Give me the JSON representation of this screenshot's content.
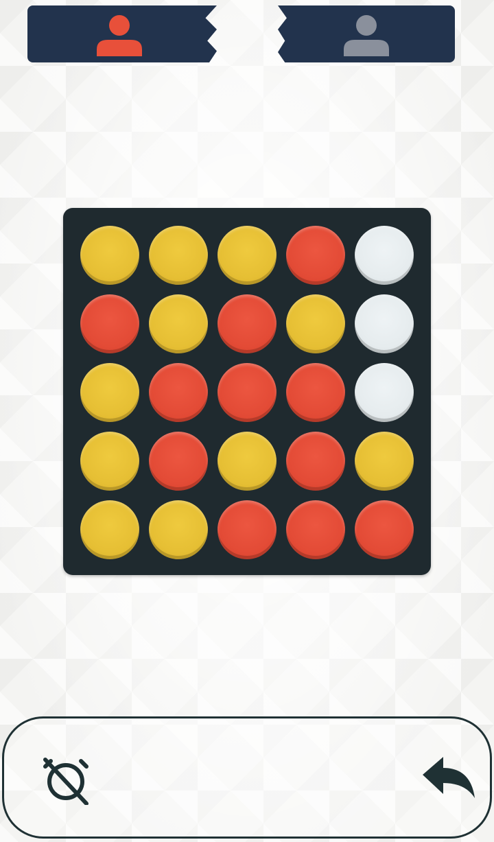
{
  "players": [
    {
      "id": "player-1",
      "color": "#e8503a",
      "icon": "user-icon",
      "active": true
    },
    {
      "id": "player-2",
      "color": "#8a909c",
      "icon": "user-icon",
      "active": false
    }
  ],
  "board": {
    "rows": 5,
    "columns": 5,
    "cells": [
      [
        "yellow",
        "yellow",
        "yellow",
        "red",
        "empty"
      ],
      [
        "red",
        "yellow",
        "red",
        "yellow",
        "empty"
      ],
      [
        "yellow",
        "red",
        "red",
        "red",
        "empty"
      ],
      [
        "yellow",
        "red",
        "yellow",
        "red",
        "yellow"
      ],
      [
        "yellow",
        "yellow",
        "red",
        "red",
        "red"
      ]
    ]
  },
  "colors": {
    "panel": "#22334d",
    "board": "#1f2a2f",
    "yellow": "#e6bf34",
    "red": "#e34b36",
    "empty": "#e6ecee",
    "toolbar_icon": "#1f3134"
  },
  "toolbar": {
    "timer_icon": "timer-off-icon",
    "undo_icon": "undo-icon"
  }
}
